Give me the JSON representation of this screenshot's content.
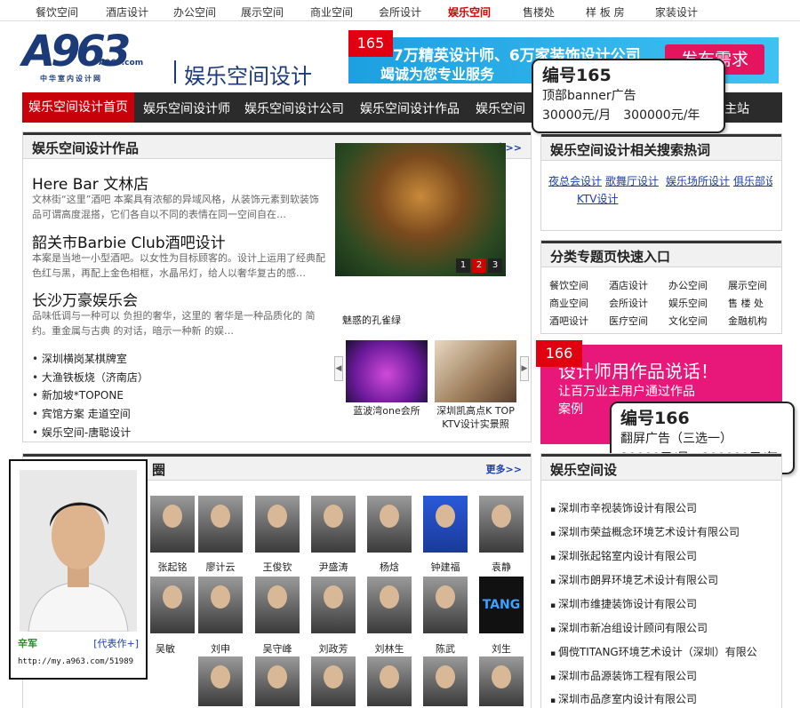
{
  "topnav": {
    "items": [
      "餐饮空间",
      "酒店设计",
      "办公空间",
      "展示空间",
      "商业空间",
      "会所设计",
      "娱乐空间",
      "售楼处",
      "样 板 房",
      "家装设计"
    ],
    "active": "娱乐空间"
  },
  "logo": {
    "mark": "A963",
    "domain": "A963.com",
    "tagline": "中华室内设计网"
  },
  "site_title": "娱乐空间设计",
  "banner": {
    "line1": "7万精英设计师、6万家装饰设计公司",
    "line2": "竭诚为您专业服务",
    "button": "发布需求"
  },
  "ad165": {
    "tag": "165",
    "title": "编号165",
    "desc": "顶部banner广告",
    "price": "30000元/月　300000元/年"
  },
  "mainnav": {
    "items": [
      "娱乐空间设计首页",
      "娱乐空间设计师",
      "娱乐空间设计公司",
      "娱乐空间设计作品",
      "娱乐空间",
      "主站"
    ]
  },
  "works": {
    "title": "娱乐空间设计作品",
    "more": "更多>>",
    "articles": [
      {
        "title": "Here Bar 文林店",
        "desc": "文林街“这里”酒吧 本案具有浓郁的异域风格，从装饰元素到软装饰品可谓高度混搭，它们各自以不同的表情在同一空间自在…"
      },
      {
        "title": "韶关市Barbie Club酒吧设计",
        "desc": "本案是当地一小型酒吧。以女性为目标顾客的。设计上运用了经典配色红与黑，再配上金色相框，水晶吊灯，给人以奢华复古的感…"
      },
      {
        "title": "长沙万豪娱乐会",
        "desc": "品味低调与一种可以 负担的奢华，这里的 奢华是一种品质化的 简约。重金属与古典 的对话，暗示一种新 的娱…"
      }
    ],
    "list": [
      "深圳横岗某棋牌室",
      "大渔铁板烧（济南店）",
      "新加坡*TOPONE",
      "宾馆方案 走道空间",
      "娱乐空间-唐聪设计"
    ],
    "featured": {
      "caption": "魅惑的孔雀绿",
      "pages": [
        "1",
        "2",
        "3"
      ],
      "active_page": "2"
    },
    "thumbs": [
      {
        "label": "蓝波湾one会所"
      },
      {
        "label": "深圳凯高点K TOP KTV设计实景照"
      }
    ]
  },
  "hot": {
    "title": "娱乐空间设计相关搜索热词",
    "links": [
      "夜总会设计",
      "歌舞厅设计",
      "娱乐场所设计",
      "俱乐部设计",
      "KTV设计"
    ]
  },
  "categories": {
    "title": "分类专题页快速入口",
    "items": [
      "餐饮空间",
      "酒店设计",
      "办公空间",
      "展示空间",
      "商业空间",
      "会所设计",
      "娱乐空间",
      "售 楼 处",
      "酒吧设计",
      "医疗空间",
      "文化空间",
      "金融机构"
    ]
  },
  "ad166": {
    "tag": "166",
    "line1": "设计师用作品说话！",
    "line2": "让百万业主用户通过作品",
    "line3": "案例",
    "title": "编号166",
    "desc": "翻屏广告（三选一）",
    "price": "10000元/月　100000元/年"
  },
  "designers": {
    "title_suffix": "圈",
    "more": "更多>>",
    "row1": [
      "张起铭",
      "廖计云",
      "王俊钦",
      "尹盛涛",
      "杨焓",
      "钟建福",
      "袁静"
    ],
    "row2": [
      "吴敏",
      "刘申",
      "吴守峰",
      "刘政芳",
      "刘林生",
      "陈武",
      "刘生"
    ],
    "logo_tile": "TANG"
  },
  "companies": {
    "title": "娱乐空间设",
    "items": [
      "深圳市辛视装饰设计有限公司",
      "深圳市荣益概念环境艺术设计有限公司",
      "深圳张起铭室内设计有限公司",
      "深圳市朗昇环境艺术设计有限公司",
      "深圳市维捷装饰设计有限公司",
      "深圳市新冶组设计顾问有限公司",
      "倜傥TITANG环境艺术设计（深圳）有限公",
      "深圳市品源装饰工程有限公司",
      "深圳市品彦室内设计有限公司"
    ]
  },
  "popup": {
    "name": "辛军",
    "rep": "[代表作+]",
    "url": "http://my.a963.com/51989"
  }
}
